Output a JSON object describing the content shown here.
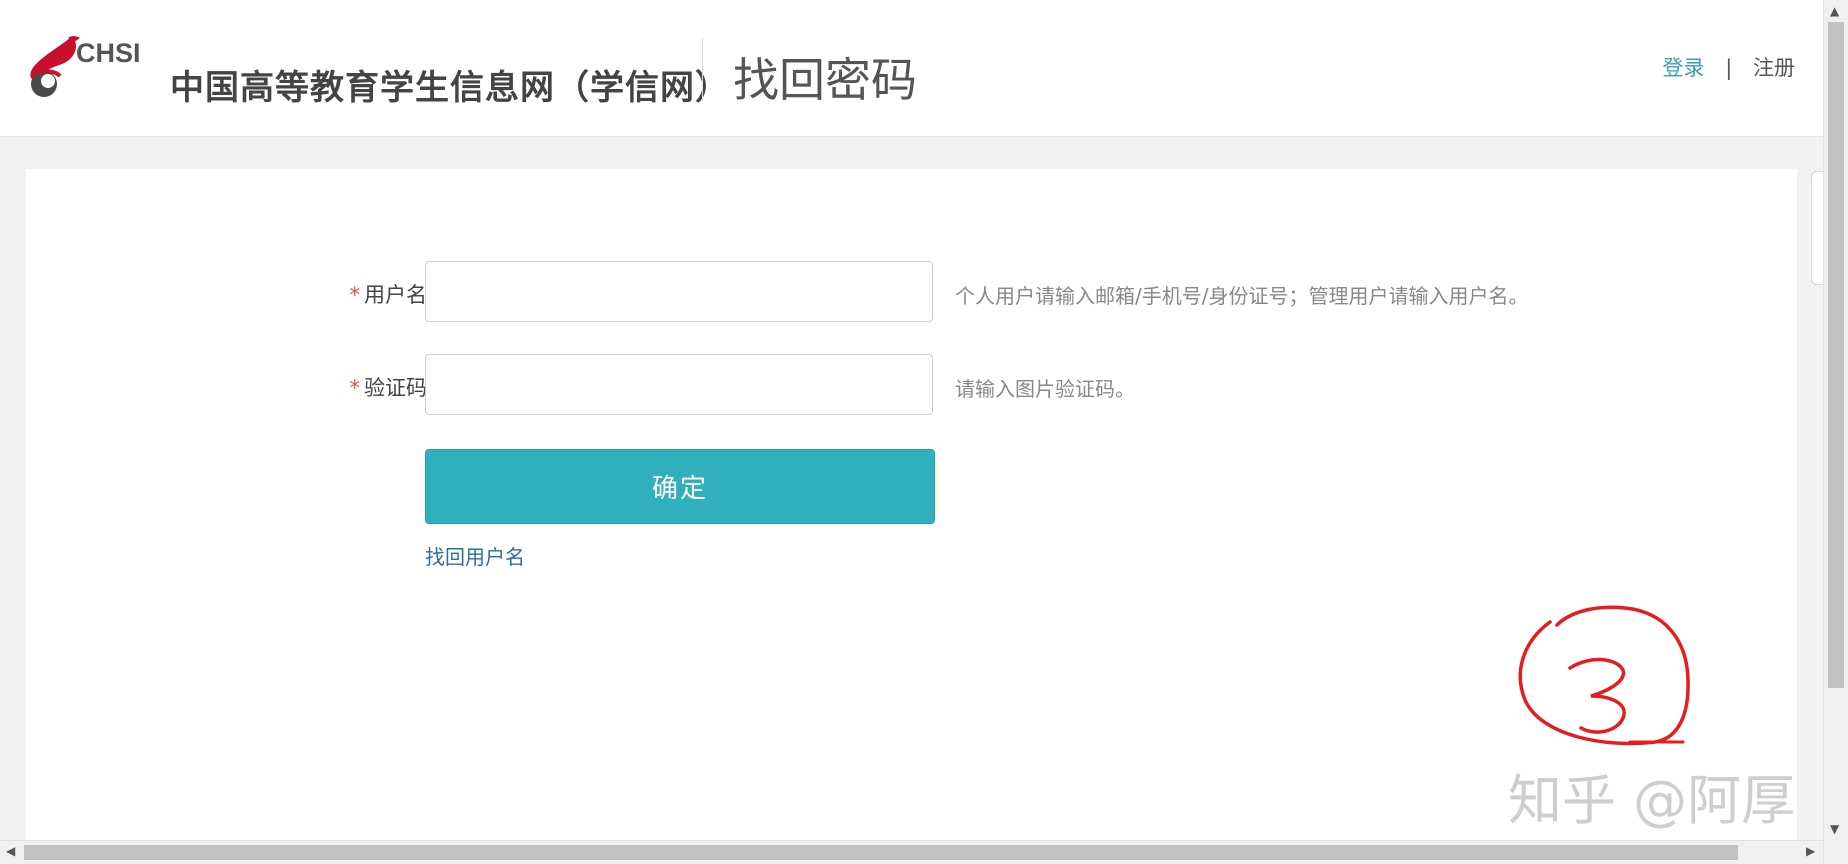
{
  "header": {
    "logo_text": "CHSI",
    "site_name": "中国高等教育学生信息网（学信网）",
    "page_title": "找回密码",
    "login_label": "登录",
    "separator": "|",
    "register_label": "注册"
  },
  "form": {
    "username": {
      "required_mark": "*",
      "label": "用户名",
      "value": "",
      "hint": "个人用户请输入邮箱/手机号/身份证号；管理用户请输入用户名。"
    },
    "captcha": {
      "required_mark": "*",
      "label": "验证码",
      "value": "",
      "hint": "请输入图片验证码。"
    },
    "confirm_label": "确定",
    "find_username_label": "找回用户名"
  },
  "overlay": {
    "watermark": "知乎 @阿厚",
    "annotation_color": "#e41e1e"
  },
  "colors": {
    "accent": "#2fb0bc",
    "link": "#3a9eb2",
    "logo_red": "#c8102e"
  },
  "scrollbars": {
    "up_arrow": "▲",
    "down_arrow": "▼",
    "left_arrow": "◀",
    "right_arrow": "▶"
  }
}
